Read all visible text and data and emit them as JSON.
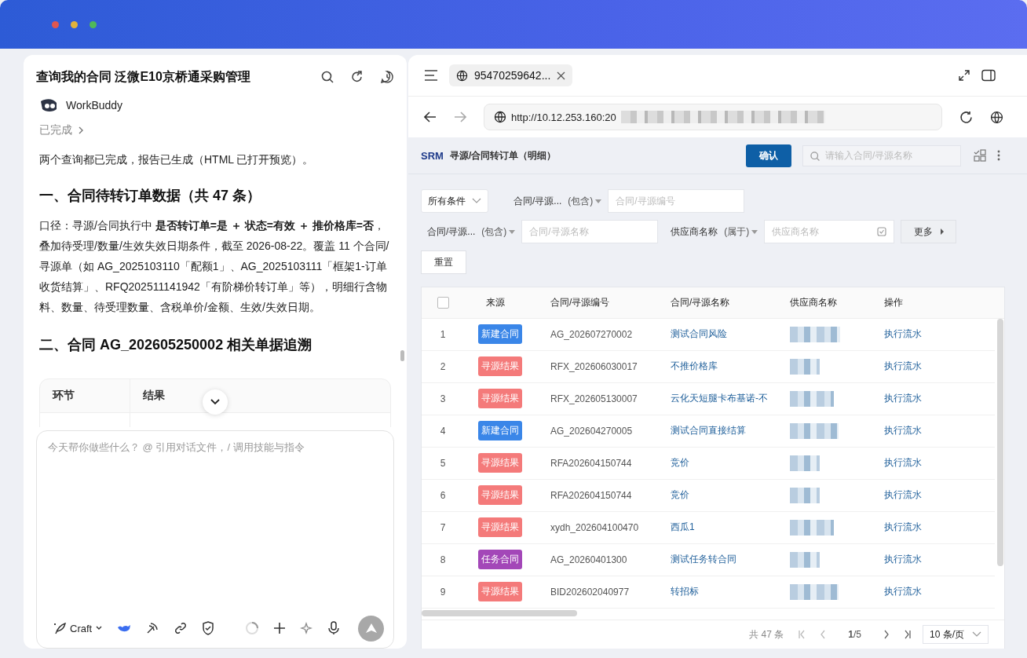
{
  "chat": {
    "title": "查询我的合同 泛微E10京桥通采购管理",
    "agent": "WorkBuddy",
    "status": "已完成",
    "intro": "两个查询都已完成，报告已生成（HTML 已打开预览）。",
    "heading1": "一、合同待转订单数据（共 47 条）",
    "paragraph": "口径：寻源/合同执行中 **是否转订单=是 ＋ 状态=有效 ＋ 推价格库=否**，叠加待受理/数量/生效失效日期条件，截至 2026-08-22。覆盖 11 个合同/寻源单（如 AG_2025103110「配额1」、AG_2025103111「框架1-订单收货结算」、RFQ202511141942「有阶梯价转订单」等），明细行含物料、数量、待受理数量、含税单价/金额、生效/失效日期。",
    "heading2": "二、合同 AG_202605250002 相关单据追溯",
    "table_columns": [
      "环节",
      "结果"
    ],
    "input": {
      "placeholder": "今天帮你做些什么？ @ 引用对话文件，/ 调用技能与指令"
    },
    "mode": "Craft"
  },
  "browser": {
    "tab": {
      "label": "95470259642...",
      "selected": true
    },
    "url": "http://10.12.253.160:20"
  },
  "app": {
    "logo": "SRM",
    "title": "寻源/合同转订单（明细）",
    "confirm": "确认",
    "search": {
      "placeholder": "请输入合同/寻源名称"
    },
    "scope": "所有条件",
    "filters": [
      {
        "label": "合同/寻源...",
        "op": "(包含)",
        "placeholder": "合同/寻源编号"
      },
      {
        "label": "合同/寻源...",
        "op": "(包含)",
        "placeholder": "合同/寻源名称"
      },
      {
        "label": "供应商名称",
        "op": "(属于)",
        "placeholder": "供应商名称"
      }
    ],
    "more": "更多",
    "reset": "重置",
    "table": {
      "select_all": {
        "checked": false
      },
      "columns": [
        "来源",
        "合同/寻源编号",
        "合同/寻源名称",
        "供应商名称",
        "操作"
      ],
      "rows": [
        {
          "no": "1",
          "source": "新建合同",
          "color": "#3a86e8",
          "code": "AG_202607270002",
          "name": "测试合同风险",
          "action": "执行流水"
        },
        {
          "no": "2",
          "source": "寻源结果",
          "color": "#f47a7a",
          "code": "RFX_202606030017",
          "name": "不推价格库",
          "action": "执行流水"
        },
        {
          "no": "3",
          "source": "寻源结果",
          "color": "#f47a7a",
          "code": "RFX_202605130007",
          "name": "云化天短腿卡布基诺-不",
          "action": "执行流水"
        },
        {
          "no": "4",
          "source": "新建合同",
          "color": "#3a86e8",
          "code": "AG_202604270005",
          "name": "测试合同直接结算",
          "action": "执行流水"
        },
        {
          "no": "5",
          "source": "寻源结果",
          "color": "#f47a7a",
          "code": "RFA202604150744",
          "name": "竞价",
          "action": "执行流水"
        },
        {
          "no": "6",
          "source": "寻源结果",
          "color": "#f47a7a",
          "code": "RFA202604150744",
          "name": "竞价",
          "action": "执行流水"
        },
        {
          "no": "7",
          "source": "寻源结果",
          "color": "#f47a7a",
          "code": "xydh_202604100470",
          "name": "西瓜1",
          "action": "执行流水"
        },
        {
          "no": "8",
          "source": "任务合同",
          "color": "#a347b8",
          "code": "AG_20260401300",
          "name": "测试任务转合同",
          "action": "执行流水"
        },
        {
          "no": "9",
          "source": "寻源结果",
          "color": "#f47a7a",
          "code": "BID202602040977",
          "name": "转招标",
          "action": "执行流水"
        }
      ]
    },
    "pagination": {
      "total": "共 47 条",
      "page": "**1**/5",
      "size": "10 条/页"
    }
  }
}
